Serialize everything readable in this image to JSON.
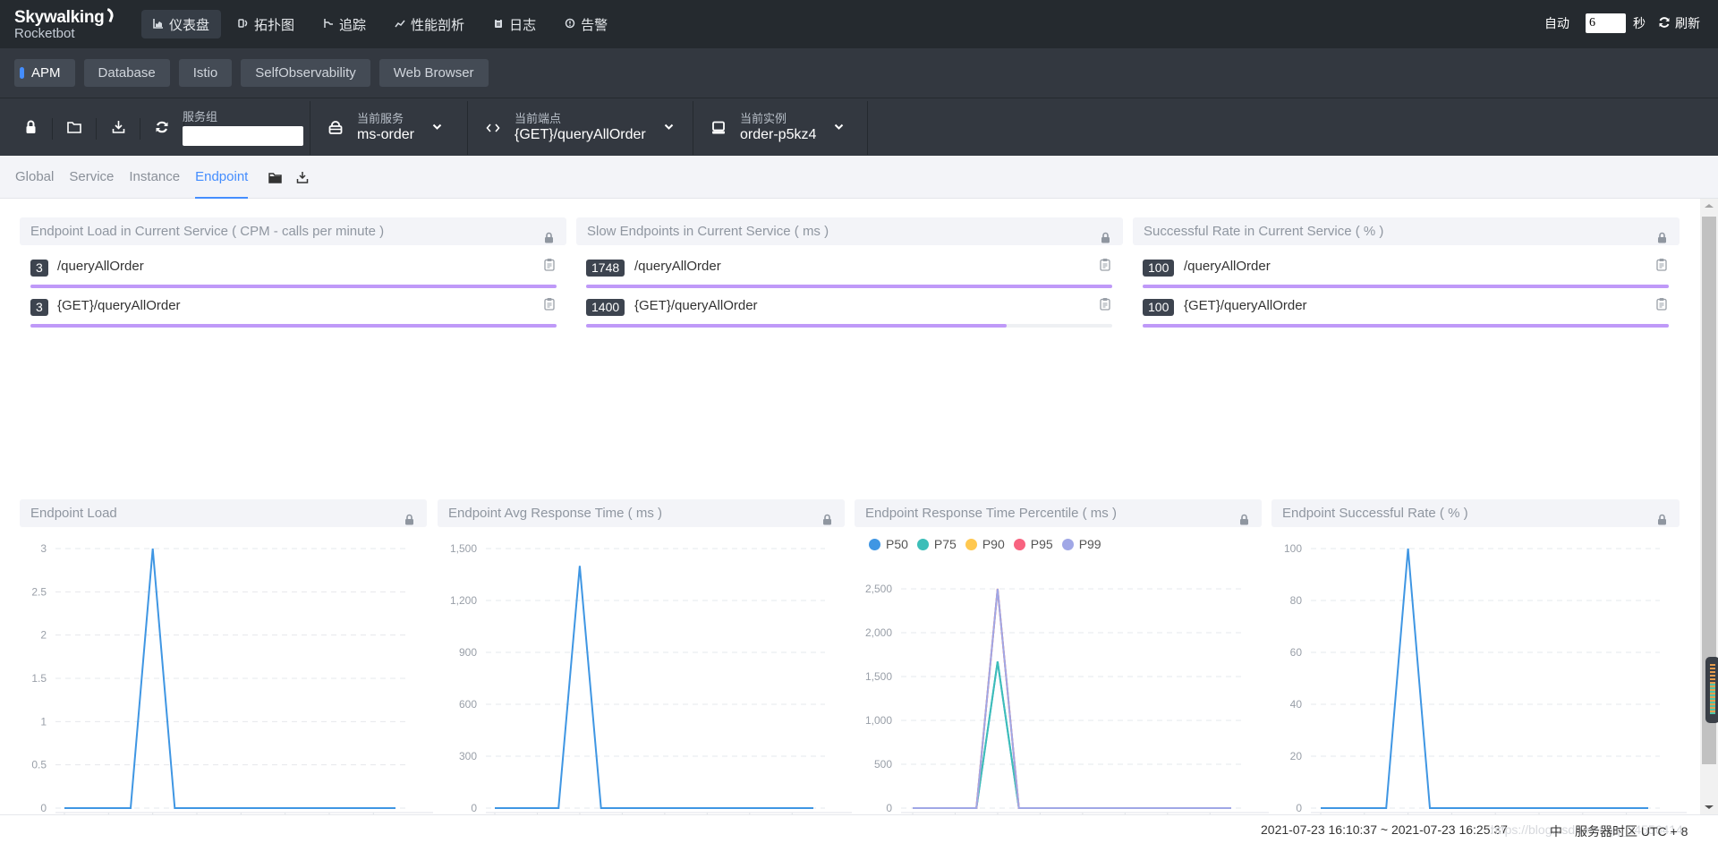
{
  "app": {
    "logo_line1": "Skywalking",
    "logo_line2": "Rocketbot"
  },
  "nav": {
    "items": [
      {
        "label": "仪表盘",
        "icon": "dashboard-icon",
        "active": true
      },
      {
        "label": "拓扑图",
        "icon": "topology-icon",
        "active": false
      },
      {
        "label": "追踪",
        "icon": "trace-icon",
        "active": false
      },
      {
        "label": "性能剖析",
        "icon": "profile-icon",
        "active": false
      },
      {
        "label": "日志",
        "icon": "log-icon",
        "active": false
      },
      {
        "label": "告警",
        "icon": "alarm-icon",
        "active": false
      }
    ],
    "auto_label": "自动",
    "auto_value": "6",
    "seconds_label": "秒",
    "refresh_label": "刷新"
  },
  "groups": {
    "items": [
      "APM",
      "Database",
      "Istio",
      "SelfObservability",
      "Web Browser"
    ],
    "active": "APM"
  },
  "toolbar": {
    "service_group_label": "服务组",
    "service_group_value": "",
    "current_service_label": "当前服务",
    "current_service_value": "ms-order",
    "current_endpoint_label": "当前端点",
    "current_endpoint_value": "{GET}/queryAllOrder",
    "current_instance_label": "当前实例",
    "current_instance_value": "order-p5kz4"
  },
  "tabs": {
    "items": [
      "Global",
      "Service",
      "Instance",
      "Endpoint"
    ],
    "active": "Endpoint"
  },
  "list_panels": [
    {
      "title": "Endpoint Load in Current Service ( CPM - calls per minute )",
      "rows": [
        {
          "value": "3",
          "name": "/queryAllOrder",
          "fraction": 1.0
        },
        {
          "value": "3",
          "name": "{GET}/queryAllOrder",
          "fraction": 1.0
        }
      ]
    },
    {
      "title": "Slow Endpoints in Current Service ( ms )",
      "rows": [
        {
          "value": "1748",
          "name": "/queryAllOrder",
          "fraction": 1.0
        },
        {
          "value": "1400",
          "name": "{GET}/queryAllOrder",
          "fraction": 0.8
        }
      ]
    },
    {
      "title": "Successful Rate in Current Service ( % )",
      "rows": [
        {
          "value": "100",
          "name": "/queryAllOrder",
          "fraction": 1.0
        },
        {
          "value": "100",
          "name": "{GET}/queryAllOrder",
          "fraction": 1.0
        }
      ]
    }
  ],
  "chart_data": [
    {
      "type": "line",
      "title": "Endpoint Load",
      "y_ticks": [
        "0",
        "0.5",
        "1",
        "1.5",
        "2",
        "2.5",
        "3"
      ],
      "ylim": [
        0,
        3
      ],
      "grid": true,
      "series": [
        {
          "name": "Endpoint Load",
          "color": "#3f96e3",
          "values": [
            0,
            0,
            0,
            0,
            3,
            0,
            0,
            0,
            0,
            0,
            0,
            0,
            0,
            0,
            0,
            0
          ]
        }
      ]
    },
    {
      "type": "line",
      "title": "Endpoint Avg Response Time ( ms )",
      "y_ticks": [
        "0",
        "300",
        "600",
        "900",
        "1,200",
        "1,500"
      ],
      "ylim": [
        0,
        1500
      ],
      "grid": true,
      "series": [
        {
          "name": "Avg Response Time",
          "color": "#3f96e3",
          "values": [
            0,
            0,
            0,
            0,
            1400,
            0,
            0,
            0,
            0,
            0,
            0,
            0,
            0,
            0,
            0,
            0
          ]
        }
      ]
    },
    {
      "type": "line",
      "title": "Endpoint Response Time Percentile ( ms )",
      "y_ticks": [
        "0",
        "500",
        "1,000",
        "1,500",
        "2,000",
        "2,500"
      ],
      "ylim": [
        0,
        2500
      ],
      "grid": true,
      "legend": "top-left",
      "series": [
        {
          "name": "P50",
          "color": "#3f96e3",
          "values": [
            0,
            0,
            0,
            0,
            1670,
            0,
            0,
            0,
            0,
            0,
            0,
            0,
            0,
            0,
            0,
            0
          ]
        },
        {
          "name": "P75",
          "color": "#3cbeb8",
          "values": [
            0,
            0,
            0,
            0,
            1670,
            0,
            0,
            0,
            0,
            0,
            0,
            0,
            0,
            0,
            0,
            0
          ]
        },
        {
          "name": "P90",
          "color": "#ffc850",
          "values": [
            0,
            0,
            0,
            0,
            2500,
            0,
            0,
            0,
            0,
            0,
            0,
            0,
            0,
            0,
            0,
            0
          ]
        },
        {
          "name": "P95",
          "color": "#f86380",
          "values": [
            0,
            0,
            0,
            0,
            2500,
            0,
            0,
            0,
            0,
            0,
            0,
            0,
            0,
            0,
            0,
            0
          ]
        },
        {
          "name": "P99",
          "color": "#a0a7e6",
          "values": [
            0,
            0,
            0,
            0,
            2500,
            0,
            0,
            0,
            0,
            0,
            0,
            0,
            0,
            0,
            0,
            0
          ]
        }
      ]
    },
    {
      "type": "line",
      "title": "Endpoint Successful Rate ( % )",
      "y_ticks": [
        "0",
        "20",
        "40",
        "60",
        "80",
        "100"
      ],
      "ylim": [
        0,
        100
      ],
      "grid": true,
      "series": [
        {
          "name": "Successful Rate",
          "color": "#3f96e3",
          "values": [
            0,
            0,
            0,
            0,
            100,
            0,
            0,
            0,
            0,
            0,
            0,
            0,
            0,
            0,
            0,
            0
          ]
        }
      ]
    }
  ],
  "footer": {
    "time_range": "2021-07-23 16:10:37 ~ 2021-07-23 16:25:37",
    "watermark": "https://blog.csdn.net/qq_34556414",
    "lang": "中",
    "timezone": "服务器时区 UTC + 8"
  }
}
